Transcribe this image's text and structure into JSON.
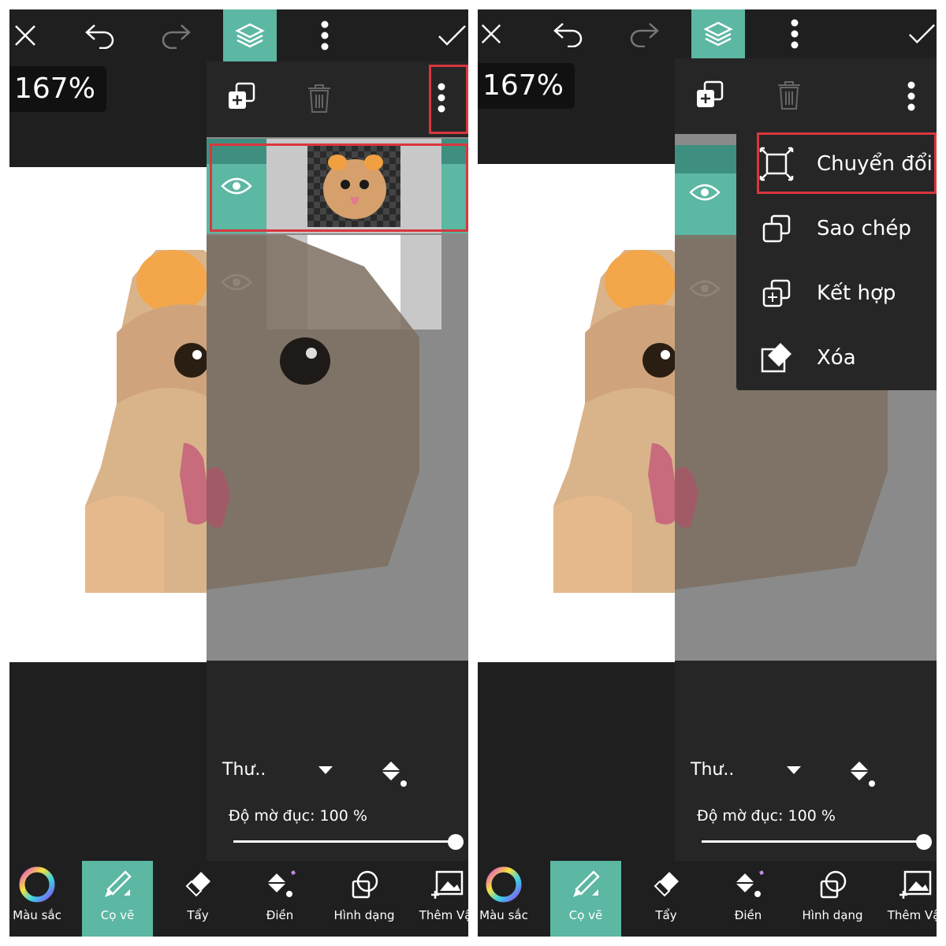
{
  "zoom_level": "167%",
  "colors": {
    "accent": "#5cb7a3",
    "dark": "#1f1f1f",
    "panel": "#262626",
    "highlight": "#d9363e"
  },
  "toolbar": {
    "icons": [
      "close-icon",
      "undo-icon",
      "redo-icon",
      "layers-icon",
      "more-vertical-icon",
      "checkmark-icon"
    ]
  },
  "layers_panel": {
    "tools": [
      "add-layer-icon",
      "trash-icon",
      "more-vertical-icon"
    ],
    "blend_mode": "Thư..",
    "opacity_label": "Độ mờ đục: 100 %",
    "opacity_value": 1.0
  },
  "context_menu": {
    "items": [
      {
        "label": "Chuyển đổi",
        "icon": "transform-icon"
      },
      {
        "label": "Sao chép",
        "icon": "duplicate-icon"
      },
      {
        "label": "Kết hợp",
        "icon": "merge-icon"
      },
      {
        "label": "Xóa",
        "icon": "eraser-icon"
      }
    ]
  },
  "bottom_tools": [
    {
      "label": "Màu sắc",
      "icon": "color-wheel-icon"
    },
    {
      "label": "Cọ vẽ",
      "icon": "brush-icon"
    },
    {
      "label": "Tẩy",
      "icon": "eraser-icon"
    },
    {
      "label": "Điền",
      "icon": "fill-bucket-icon"
    },
    {
      "label": "Hình dạng",
      "icon": "shape-icon"
    },
    {
      "label": "Thêm Vật",
      "icon": "add-image-icon"
    }
  ]
}
